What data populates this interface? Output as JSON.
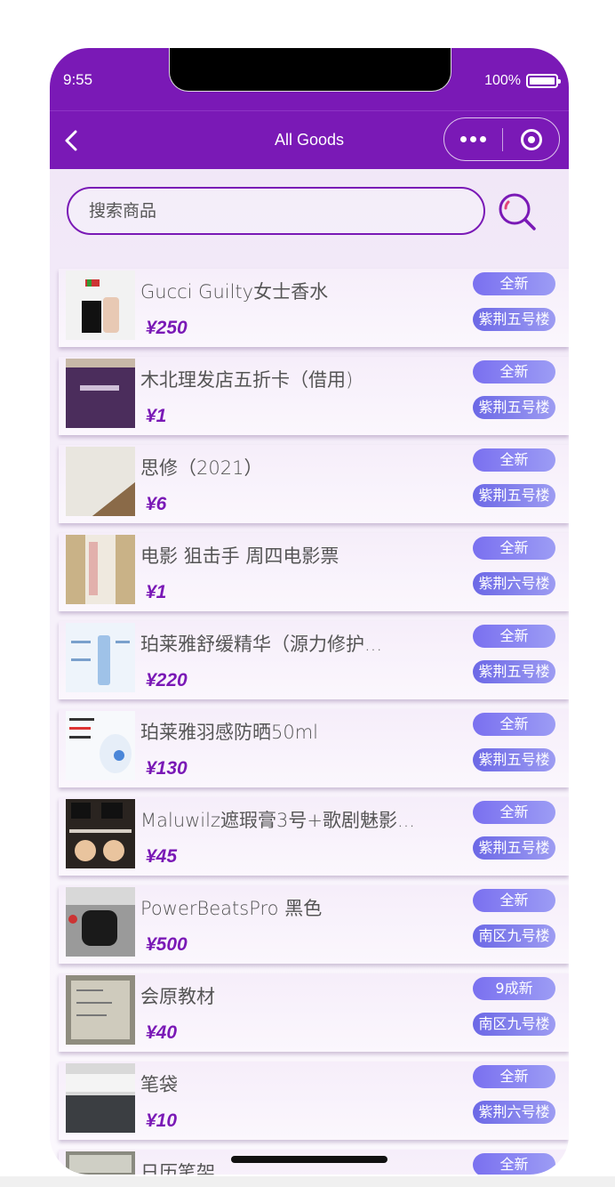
{
  "status_bar": {
    "time": "9:55",
    "battery": "100%"
  },
  "nav": {
    "title": "All Goods"
  },
  "search": {
    "placeholder": "搜索商品"
  },
  "items": [
    {
      "title": "Gucci Guilty女士香水",
      "price": "¥250",
      "condition": "全新",
      "location": "紫荆五号楼"
    },
    {
      "title": "木北理发店五折卡（借用)",
      "price": "¥1",
      "condition": "全新",
      "location": "紫荆五号楼"
    },
    {
      "title": "思修（2021）",
      "price": "¥6",
      "condition": "全新",
      "location": "紫荆五号楼"
    },
    {
      "title": "电影 狙击手 周四电影票",
      "price": "¥1",
      "condition": "全新",
      "location": "紫荆六号楼"
    },
    {
      "title": "珀莱雅舒缓精华（源力修护...",
      "price": "¥220",
      "condition": "全新",
      "location": "紫荆五号楼"
    },
    {
      "title": "珀莱雅羽感防晒50ml",
      "price": "¥130",
      "condition": "全新",
      "location": "紫荆五号楼"
    },
    {
      "title": "Maluwilz遮瑕膏3号+歌剧魅影...",
      "price": "¥45",
      "condition": "全新",
      "location": "紫荆五号楼"
    },
    {
      "title": "PowerBeatsPro 黑色",
      "price": "¥500",
      "condition": "全新",
      "location": "南区九号楼"
    },
    {
      "title": "会原教材",
      "price": "¥40",
      "condition": "9成新",
      "location": "南区九号楼"
    },
    {
      "title": "笔袋",
      "price": "¥10",
      "condition": "全新",
      "location": "紫荆六号楼"
    },
    {
      "title": "日历笔架",
      "price": "",
      "condition": "全新",
      "location": ""
    }
  ]
}
